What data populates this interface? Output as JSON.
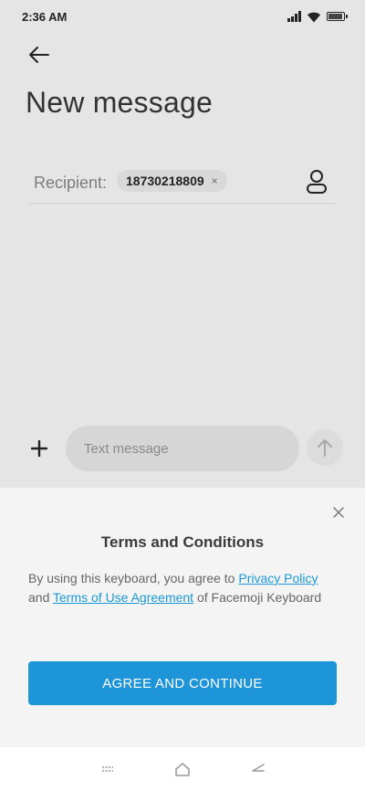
{
  "status_bar": {
    "time": "2:36 AM",
    "icons": [
      "signal-icon",
      "wifi-icon",
      "battery-icon"
    ]
  },
  "header": {
    "title": "New message",
    "back_icon": "back-arrow-icon"
  },
  "recipient": {
    "label": "Recipient:",
    "chip_number": "18730218809",
    "chip_remove": "×",
    "contact_icon": "contact-icon"
  },
  "composer": {
    "placeholder": "Text message",
    "add_icon": "plus-icon",
    "send_icon": "send-arrow-icon"
  },
  "terms": {
    "title": "Terms and Conditions",
    "text_1": "By using this keyboard, you agree to ",
    "link_1": "Privacy Policy",
    "text_2": " and ",
    "link_2": "Terms of Use Agreement",
    "text_3": " of Facemoji Keyboard",
    "button": "AGREE AND CONTINUE",
    "close_icon": "close-icon"
  },
  "navbar": {
    "icons": [
      "menu-icon",
      "home-icon",
      "back-icon"
    ]
  },
  "colors": {
    "accent": "#1e95d8",
    "link": "#1a98d5",
    "background": "#e5e5e5",
    "sheet": "#f4f4f4"
  }
}
